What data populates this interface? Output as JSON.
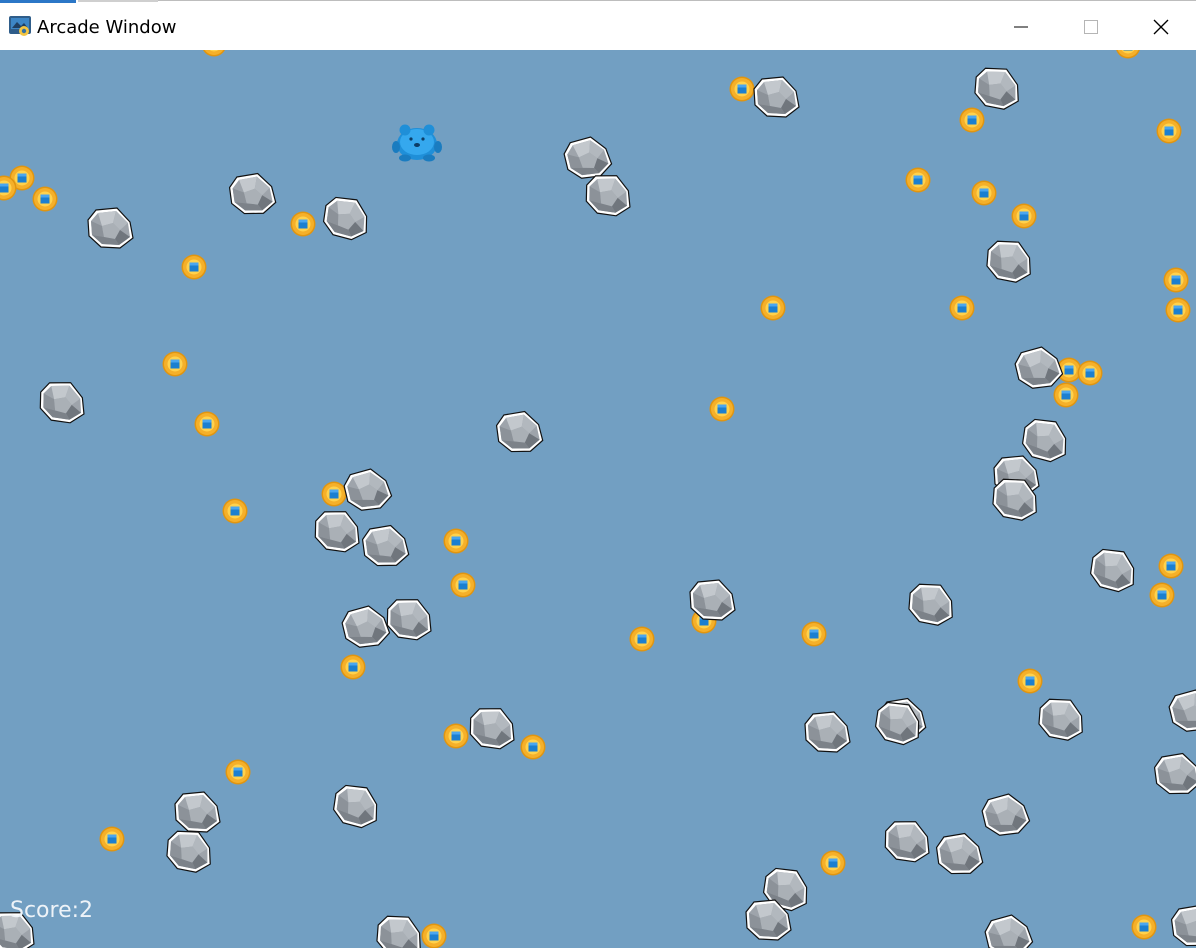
{
  "window": {
    "title": "Arcade Window",
    "controls": [
      "minimize",
      "maximize",
      "close"
    ]
  },
  "game": {
    "background_color": "#729fc2",
    "hud": {
      "score_text": "Score:2"
    },
    "player": {
      "icon": "blue-bear-sprite",
      "color": "#2a9fe6"
    },
    "coin": {
      "icon": "gold-coin-sprite",
      "rim_color": "#f2a81d",
      "center_color": "#1e86d6"
    },
    "rock": {
      "icon": "grey-rock-sprite",
      "color": "#a8adb3"
    }
  }
}
